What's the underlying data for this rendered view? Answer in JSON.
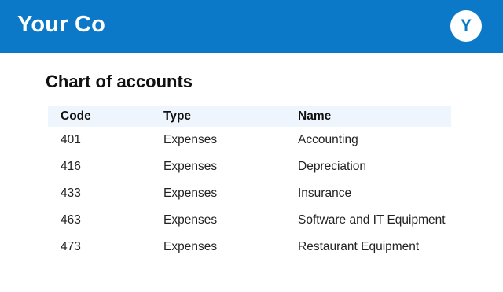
{
  "header": {
    "brand": "Your Co",
    "avatar_initial": "Y"
  },
  "main": {
    "title": "Chart of accounts",
    "table": {
      "columns": [
        "Code",
        "Type",
        "Name"
      ],
      "rows": [
        {
          "code": "401",
          "type": "Expenses",
          "name": "Accounting"
        },
        {
          "code": "416",
          "type": "Expenses",
          "name": "Depreciation"
        },
        {
          "code": "433",
          "type": "Expenses",
          "name": "Insurance"
        },
        {
          "code": "463",
          "type": "Expenses",
          "name": "Software and IT Equipment"
        },
        {
          "code": "473",
          "type": "Expenses",
          "name": "Restaurant Equipment"
        }
      ]
    }
  },
  "colors": {
    "header_bg": "#0b78c8",
    "table_header_bg": "#eef5fc"
  }
}
